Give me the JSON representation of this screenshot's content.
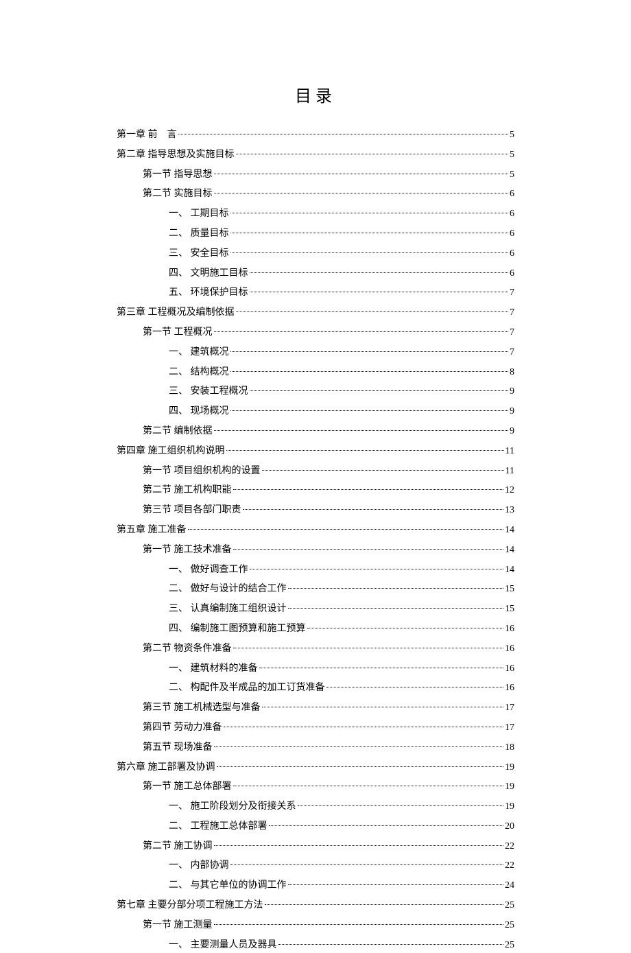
{
  "title": "目录",
  "toc": [
    {
      "level": 0,
      "label": "第一章 前　言",
      "page": "5"
    },
    {
      "level": 0,
      "label": "第二章 指导思想及实施目标",
      "page": "5"
    },
    {
      "level": 1,
      "label": "第一节 指导思想",
      "page": "5"
    },
    {
      "level": 1,
      "label": "第二节 实施目标",
      "page": "6"
    },
    {
      "level": 2,
      "label": "一、 工期目标",
      "page": "6"
    },
    {
      "level": 2,
      "label": "二、 质量目标",
      "page": "6"
    },
    {
      "level": 2,
      "label": "三、 安全目标",
      "page": "6"
    },
    {
      "level": 2,
      "label": "四、 文明施工目标",
      "page": "6"
    },
    {
      "level": 2,
      "label": "五、 环境保护目标",
      "page": "7"
    },
    {
      "level": 0,
      "label": "第三章 工程概况及编制依据",
      "page": "7"
    },
    {
      "level": 1,
      "label": "第一节 工程概况",
      "page": "7"
    },
    {
      "level": 2,
      "label": "一、 建筑概况",
      "page": "7"
    },
    {
      "level": 2,
      "label": "二、 结构概况",
      "page": "8"
    },
    {
      "level": 2,
      "label": "三、 安装工程概况",
      "page": "9"
    },
    {
      "level": 2,
      "label": "四、 现场概况",
      "page": "9"
    },
    {
      "level": 1,
      "label": "第二节 编制依据",
      "page": "9"
    },
    {
      "level": 0,
      "label": "第四章 施工组织机构说明",
      "page": "11"
    },
    {
      "level": 1,
      "label": "第一节 项目组织机构的设置",
      "page": "11"
    },
    {
      "level": 1,
      "label": "第二节 施工机构职能",
      "page": "12"
    },
    {
      "level": 1,
      "label": "第三节 项目各部门职责",
      "page": "13"
    },
    {
      "level": 0,
      "label": "第五章 施工准备",
      "page": "14"
    },
    {
      "level": 1,
      "label": "第一节 施工技术准备",
      "page": "14"
    },
    {
      "level": 2,
      "label": "一、 做好调查工作",
      "page": "14"
    },
    {
      "level": 2,
      "label": "二、 做好与设计的结合工作",
      "page": "15"
    },
    {
      "level": 2,
      "label": "三、 认真编制施工组织设计",
      "page": "15"
    },
    {
      "level": 2,
      "label": "四、 编制施工图预算和施工预算",
      "page": "16"
    },
    {
      "level": 1,
      "label": "第二节 物资条件准备",
      "page": "16"
    },
    {
      "level": 2,
      "label": "一、 建筑材料的准备",
      "page": "16"
    },
    {
      "level": 2,
      "label": "二、 构配件及半成品的加工订货准备",
      "page": "16"
    },
    {
      "level": 1,
      "label": "第三节 施工机械选型与准备",
      "page": "17"
    },
    {
      "level": 1,
      "label": "第四节 劳动力准备",
      "page": "17"
    },
    {
      "level": 1,
      "label": "第五节 现场准备",
      "page": "18"
    },
    {
      "level": 0,
      "label": "第六章 施工部署及协调",
      "page": "19"
    },
    {
      "level": 1,
      "label": "第一节 施工总体部署",
      "page": "19"
    },
    {
      "level": 2,
      "label": "一、 施工阶段划分及衔接关系",
      "page": "19"
    },
    {
      "level": 2,
      "label": "二、 工程施工总体部署",
      "page": "20"
    },
    {
      "level": 1,
      "label": "第二节 施工协调",
      "page": "22"
    },
    {
      "level": 2,
      "label": "一、 内部协调",
      "page": "22"
    },
    {
      "level": 2,
      "label": "二、 与其它单位的协调工作",
      "page": "24"
    },
    {
      "level": 0,
      "label": "第七章 主要分部分项工程施工方法",
      "page": "25"
    },
    {
      "level": 1,
      "label": "第一节 施工测量",
      "page": "25"
    },
    {
      "level": 2,
      "label": "一、 主要测量人员及器具",
      "page": "25"
    }
  ]
}
